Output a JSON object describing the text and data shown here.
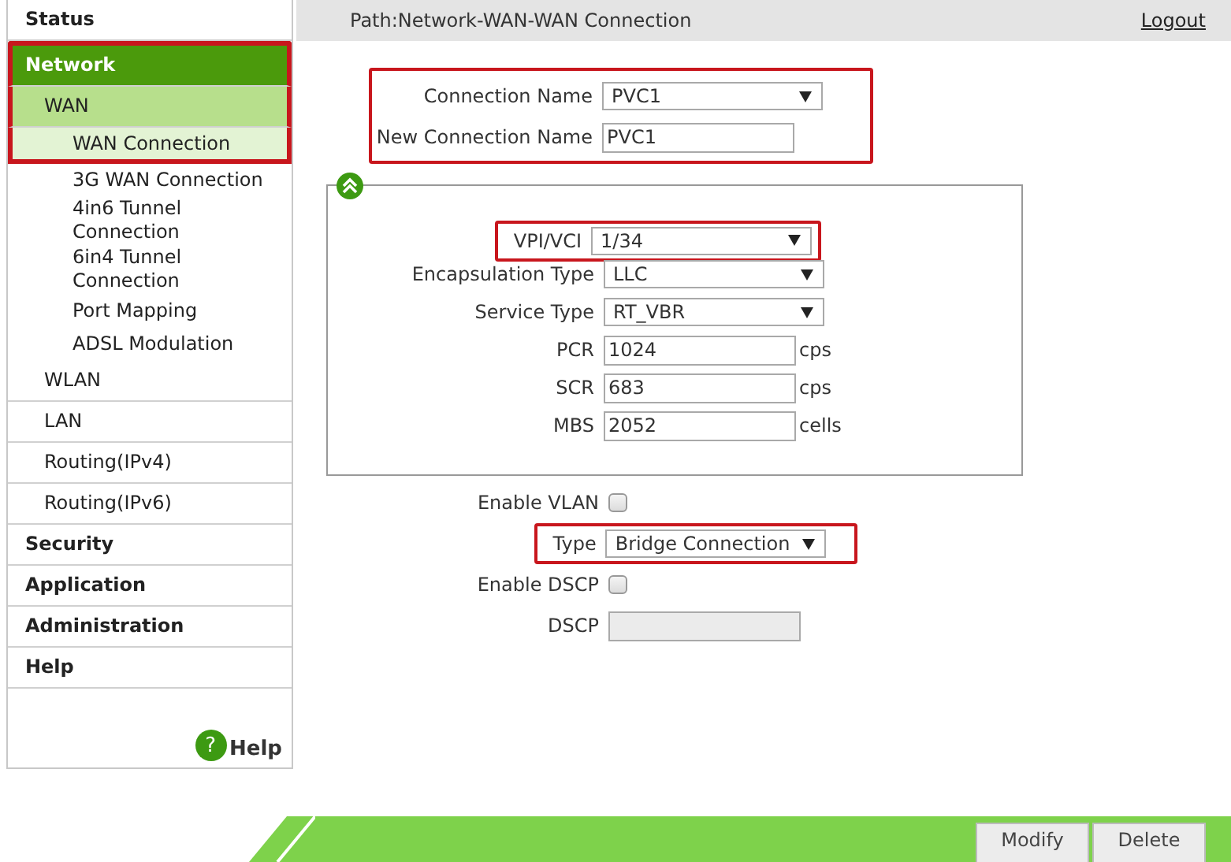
{
  "header": {
    "path": "Path:Network-WAN-WAN Connection",
    "logout": "Logout"
  },
  "sidebar": {
    "items": [
      {
        "label": "Status",
        "selected": false,
        "highlighted": false
      },
      {
        "label": "Network",
        "selected": true,
        "highlighted": true,
        "children": [
          {
            "label": "WAN",
            "selected": true,
            "highlighted": true,
            "children": [
              {
                "label": "WAN Connection",
                "selected": true,
                "highlighted": true
              },
              {
                "label": "3G WAN Connection",
                "selected": false,
                "highlighted": false
              },
              {
                "label": "4in6 Tunnel Connection",
                "selected": false,
                "highlighted": false
              },
              {
                "label": "6in4 Tunnel Connection",
                "selected": false,
                "highlighted": false
              },
              {
                "label": "Port Mapping",
                "selected": false,
                "highlighted": false
              },
              {
                "label": "ADSL Modulation",
                "selected": false,
                "highlighted": false
              }
            ]
          },
          {
            "label": "WLAN",
            "selected": false,
            "highlighted": false
          },
          {
            "label": "LAN",
            "selected": false,
            "highlighted": false
          },
          {
            "label": "Routing(IPv4)",
            "selected": false,
            "highlighted": false
          },
          {
            "label": "Routing(IPv6)",
            "selected": false,
            "highlighted": false
          }
        ]
      },
      {
        "label": "Security",
        "selected": false,
        "highlighted": false
      },
      {
        "label": "Application",
        "selected": false,
        "highlighted": false
      },
      {
        "label": "Administration",
        "selected": false,
        "highlighted": false
      },
      {
        "label": "Help",
        "selected": false,
        "highlighted": false
      }
    ],
    "help": {
      "icon": "?",
      "label": "Help"
    }
  },
  "connection": {
    "highlighted": true,
    "fields": [
      {
        "kind": "select",
        "label": "Connection Name",
        "value": "PVC1"
      },
      {
        "kind": "text",
        "label": "New Connection Name",
        "value": "PVC1"
      }
    ]
  },
  "atm": {
    "expanded": true,
    "fields": [
      {
        "kind": "select",
        "label": "VPI/VCI",
        "value": "1/34",
        "highlighted": true
      },
      {
        "kind": "select",
        "label": "Encapsulation Type",
        "value": "LLC",
        "highlighted": false
      },
      {
        "kind": "select",
        "label": "Service Type",
        "value": "RT_VBR",
        "highlighted": false
      },
      {
        "kind": "text",
        "label": "PCR",
        "value": "1024",
        "unit": "cps",
        "highlighted": false
      },
      {
        "kind": "text",
        "label": "SCR",
        "value": "683",
        "unit": "cps",
        "highlighted": false
      },
      {
        "kind": "text",
        "label": "MBS",
        "value": "2052",
        "unit": "cells",
        "highlighted": false
      }
    ]
  },
  "options": [
    {
      "kind": "checkbox",
      "label": "Enable VLAN",
      "checked": false,
      "highlighted": false
    },
    {
      "kind": "select",
      "label": "Type",
      "value": "Bridge Connection",
      "highlighted": true
    },
    {
      "kind": "checkbox",
      "label": "Enable DSCP",
      "checked": false,
      "highlighted": false
    },
    {
      "kind": "text",
      "label": "DSCP",
      "disabled": true,
      "highlighted": false
    }
  ],
  "buttons": [
    {
      "label": "Modify"
    },
    {
      "label": "Delete"
    }
  ]
}
